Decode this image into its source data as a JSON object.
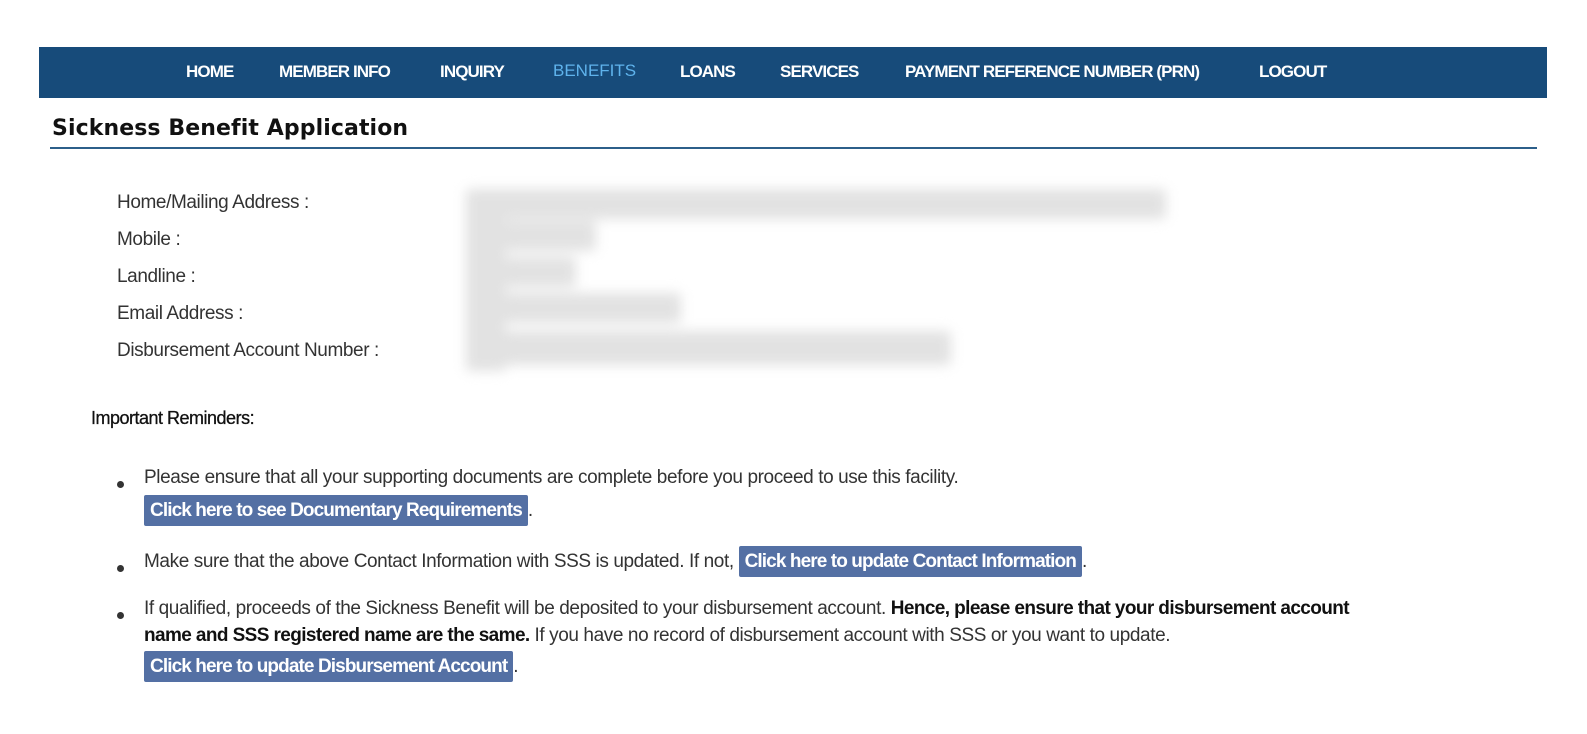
{
  "nav": {
    "items": [
      {
        "label": "HOME",
        "active": false
      },
      {
        "label": "MEMBER INFO",
        "active": false
      },
      {
        "label": "INQUIRY",
        "active": false
      },
      {
        "label": "BENEFITS",
        "active": true
      },
      {
        "label": "LOANS",
        "active": false
      },
      {
        "label": "SERVICES",
        "active": false
      },
      {
        "label": "PAYMENT REFERENCE NUMBER (PRN)",
        "active": false
      },
      {
        "label": "LOGOUT",
        "active": false
      }
    ],
    "colors": {
      "background": "#174b7a",
      "text": "#ffffff",
      "active_text": "#5fb3ec"
    }
  },
  "page": {
    "title": "Sickness Benefit Application"
  },
  "contact_info": {
    "fields": [
      {
        "label": "Home/Mailing Address :",
        "value_redacted": true
      },
      {
        "label": "Mobile :",
        "value_redacted": true
      },
      {
        "label": "Landline :",
        "value_redacted": true
      },
      {
        "label": "Email Address :",
        "value_redacted": true
      },
      {
        "label": "Disbursement Account Number :",
        "value_redacted": true
      }
    ]
  },
  "reminders": {
    "heading": "Important Reminders:",
    "items": [
      {
        "text": "Please ensure that all your supporting documents are complete before you proceed to use this facility.",
        "button": "Click here to see Documentary Requirements",
        "suffix": "."
      },
      {
        "text": "Make sure that the above Contact Information with SSS is updated. If not,",
        "button": "Click here to update Contact Information",
        "suffix": "."
      },
      {
        "text_before": "If qualified, proceeds of the Sickness Benefit will be deposited to your disbursement account.",
        "bold_line1": "Hence, please ensure that your disbursement account",
        "bold_line2": "name and SSS registered name are the same.",
        "text_after": "If you have no record of disbursement account with SSS or you want to update.",
        "button": "Click here to update Disbursement Account",
        "suffix": "."
      }
    ],
    "button_color": "#5470a4"
  }
}
